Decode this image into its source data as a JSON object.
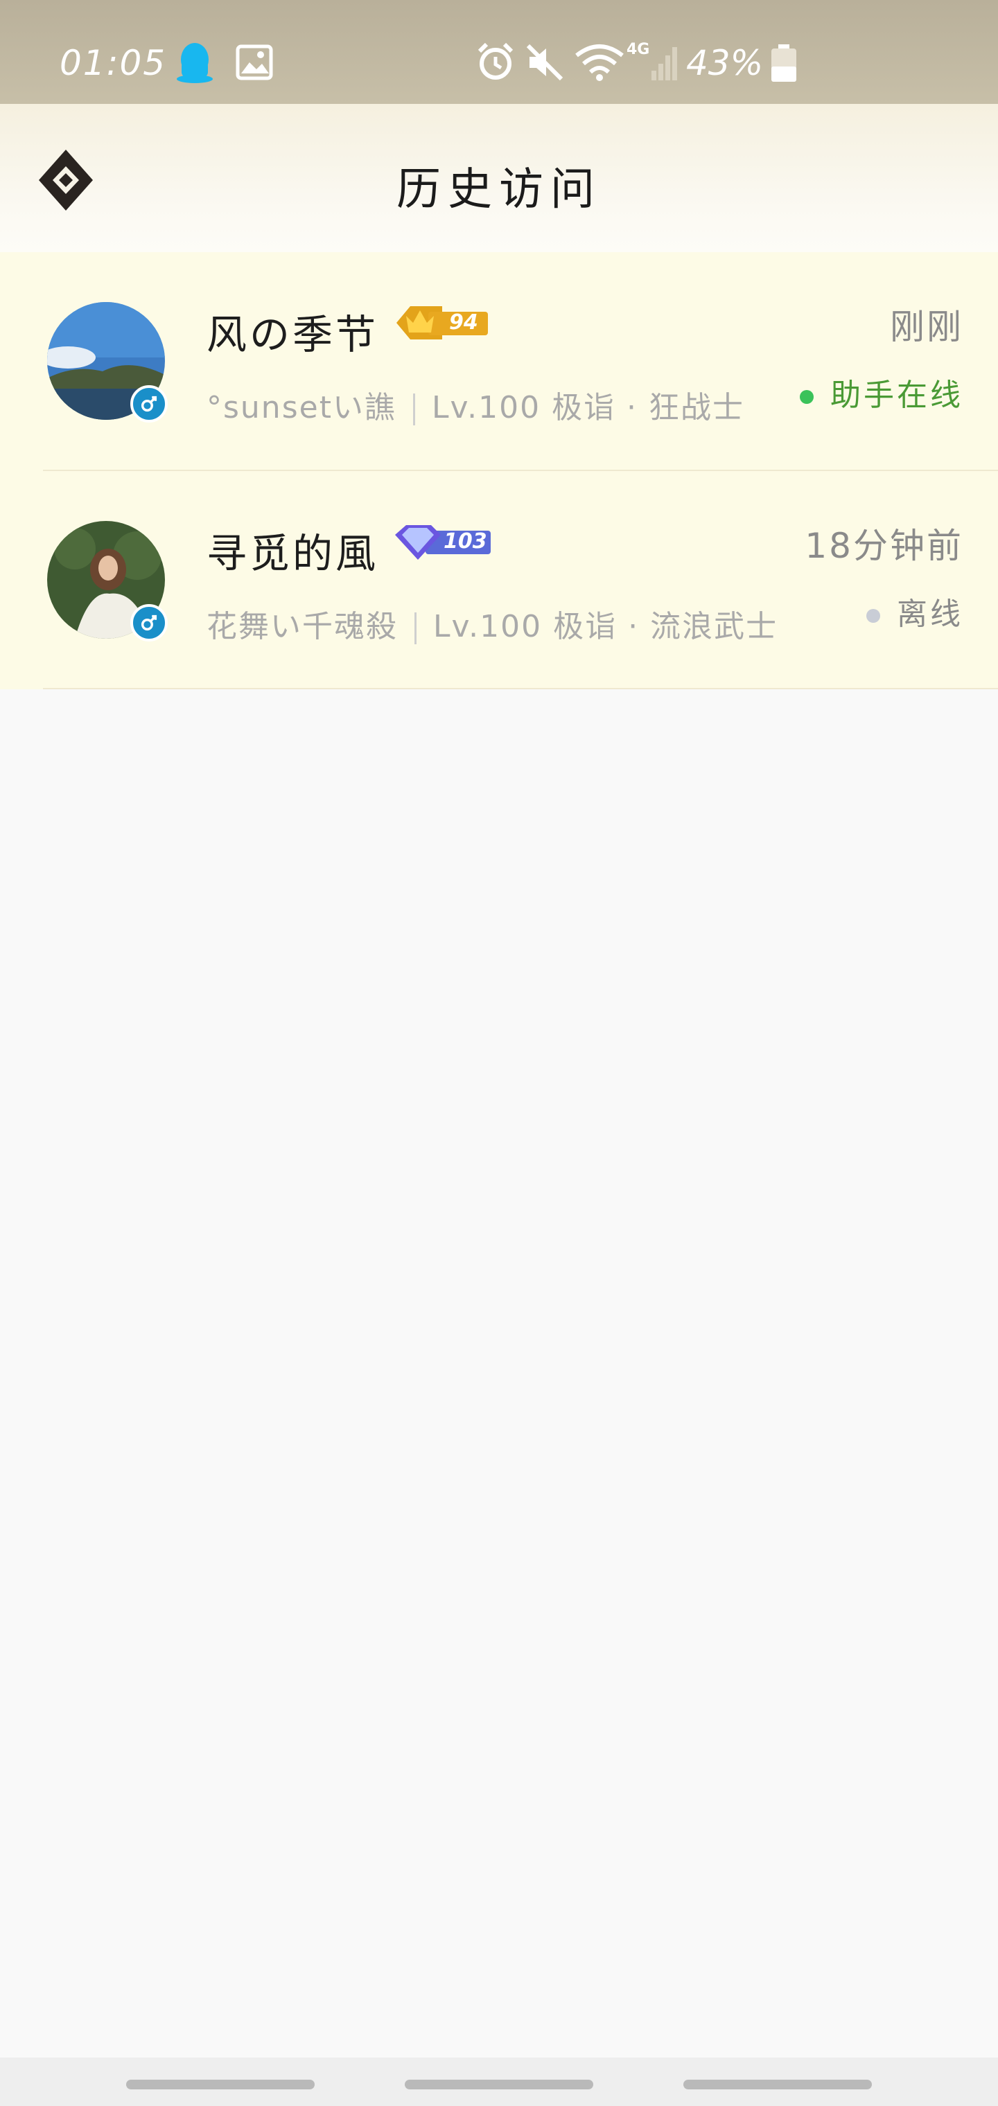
{
  "status_bar": {
    "time": "01:05",
    "battery_percent": "43%",
    "icons": [
      "qq-icon",
      "image-icon",
      "alarm-icon",
      "mute-icon",
      "wifi-icon",
      "signal-4g-icon",
      "battery-icon"
    ],
    "network_label": "4G"
  },
  "header": {
    "title": "历史访问",
    "back_icon": "diamond-back-icon"
  },
  "visitors": [
    {
      "name": "风の季节",
      "badge_level": "94",
      "badge_type": "crown",
      "time": "刚刚",
      "guild": "°sunsetい譙",
      "level": "Lv.100",
      "rank": "极诣",
      "class": "狂战士",
      "status": "助手在线",
      "status_color": "#3bc25a",
      "gender": "male"
    },
    {
      "name": "寻觅的風",
      "badge_level": "103",
      "badge_type": "diamond",
      "time": "18分钟前",
      "guild": "花舞い千魂殺",
      "level": "Lv.100",
      "rank": "极诣",
      "class": "流浪武士",
      "status": "离线",
      "status_color": "#c9cdd6",
      "gender": "male"
    }
  ],
  "colors": {
    "row_bg": "#fdfbe6",
    "online_text": "#4a9a35",
    "offline_text": "#8a8a8a",
    "gender_badge": "#1a8fc9"
  }
}
